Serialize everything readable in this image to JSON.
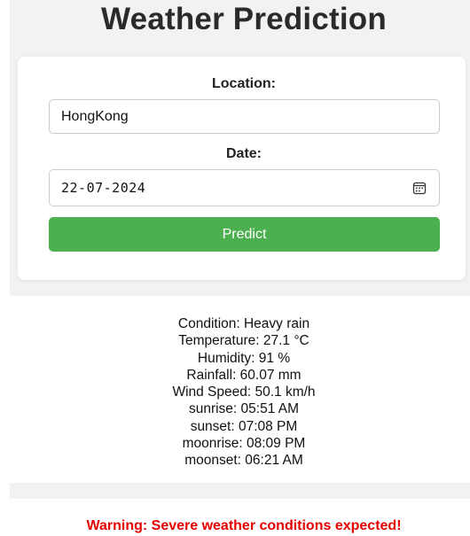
{
  "header": {
    "title": "Weather Prediction"
  },
  "form": {
    "location_label": "Location:",
    "location_value": "HongKong",
    "date_label": "Date:",
    "date_value": "22-07-2024",
    "date_icon": "calendar-icon",
    "predict_label": "Predict"
  },
  "results": {
    "condition": "Condition: Heavy rain",
    "temperature": "Temperature: 27.1 °C",
    "humidity": "Humidity: 91 %",
    "rainfall": "Rainfall: 60.07 mm",
    "wind_speed": "Wind Speed: 50.1 km/h",
    "sunrise": "sunrise: 05:51 AM",
    "sunset": "sunset: 07:08 PM",
    "moonrise": "moonrise: 08:09 PM",
    "moonset": "moonset: 06:21 AM"
  },
  "warning": {
    "text": "Warning: Severe weather conditions expected!"
  },
  "colors": {
    "button": "#4caf50",
    "warning": "#e60000",
    "panel_background": "#f2f2f2"
  }
}
